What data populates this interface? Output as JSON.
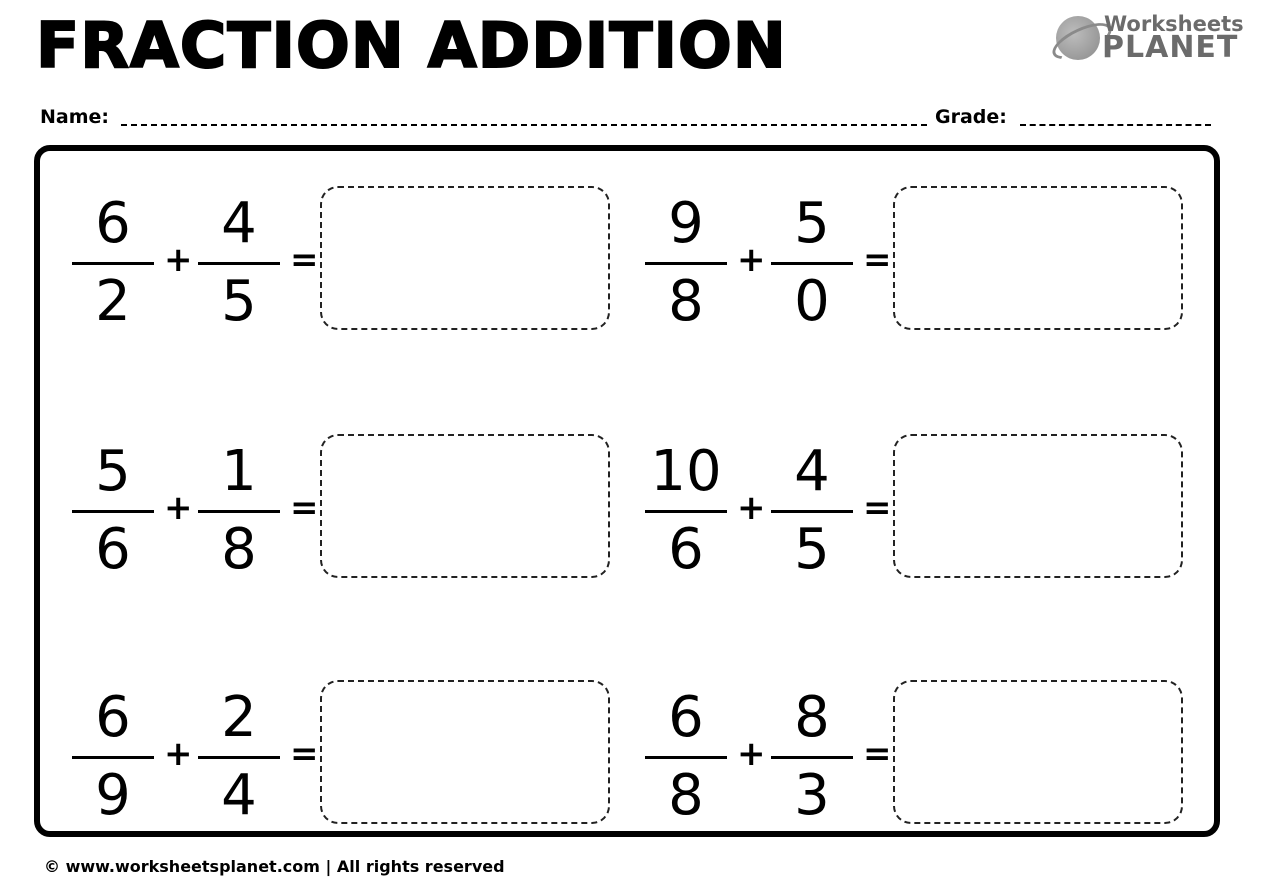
{
  "header": {
    "title": "FRACTION ADDITION",
    "logo": {
      "line1": "Worksheets",
      "line2": "PLANET",
      "icon": "planet-icon"
    }
  },
  "fields": {
    "name_label": "Name:",
    "grade_label": "Grade:"
  },
  "operators": {
    "plus": "+",
    "equals": "="
  },
  "problems": [
    {
      "a_num": "6",
      "a_den": "2",
      "b_num": "4",
      "b_den": "5"
    },
    {
      "a_num": "9",
      "a_den": "8",
      "b_num": "5",
      "b_den": "0"
    },
    {
      "a_num": "5",
      "a_den": "6",
      "b_num": "1",
      "b_den": "8"
    },
    {
      "a_num": "10",
      "a_den": "6",
      "b_num": "4",
      "b_den": "5"
    },
    {
      "a_num": "6",
      "a_den": "9",
      "b_num": "2",
      "b_den": "4"
    },
    {
      "a_num": "6",
      "a_den": "8",
      "b_num": "8",
      "b_den": "3"
    }
  ],
  "footer": {
    "copyright_symbol": "©",
    "website": "www.worksheetsplanet.com",
    "separator": "|",
    "rights": "All rights reserved"
  }
}
